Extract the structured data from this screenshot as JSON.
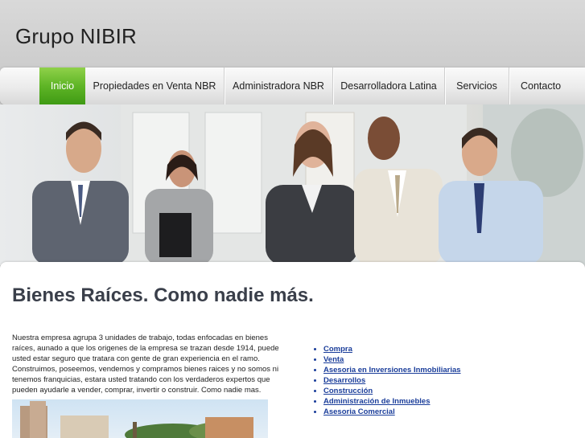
{
  "site": {
    "title": "Grupo NIBIR"
  },
  "nav": {
    "items": [
      {
        "label": "Inicio",
        "active": true
      },
      {
        "label": "Propiedades en Venta NBR"
      },
      {
        "label": "Administradora NBR"
      },
      {
        "label": "Desarrolladora Latina"
      },
      {
        "label": "Servicios"
      },
      {
        "label": "Contacto"
      }
    ]
  },
  "colors": {
    "accent": "#5fb526",
    "link": "#1a3d9a",
    "heading": "#3a3f4a"
  },
  "main": {
    "headline": "Bienes Raíces. Como nadie más.",
    "intro": "Nuestra empresa agrupa 3 unidades de trabajo, todas enfocadas en bienes raíces, aunado a que los origenes de la empresa se trazan desde 1914, puede usted estar seguro que tratara con gente de gran experiencia en el ramo. Construimos, poseemos, vendemos y compramos bienes raices y no somos ni tenemos franquicias, estara usted tratando con los verdaderos expertos que pueden ayudarle a vender, comprar, invertir o construir. Como nadie mas.",
    "services": [
      "Compra",
      "Venta",
      "Asesoria en Inversiones Inmobiliarias",
      "Desarrollos",
      "Construcción",
      "Administración de Inmuebles",
      "Asesoria Comercial"
    ]
  }
}
